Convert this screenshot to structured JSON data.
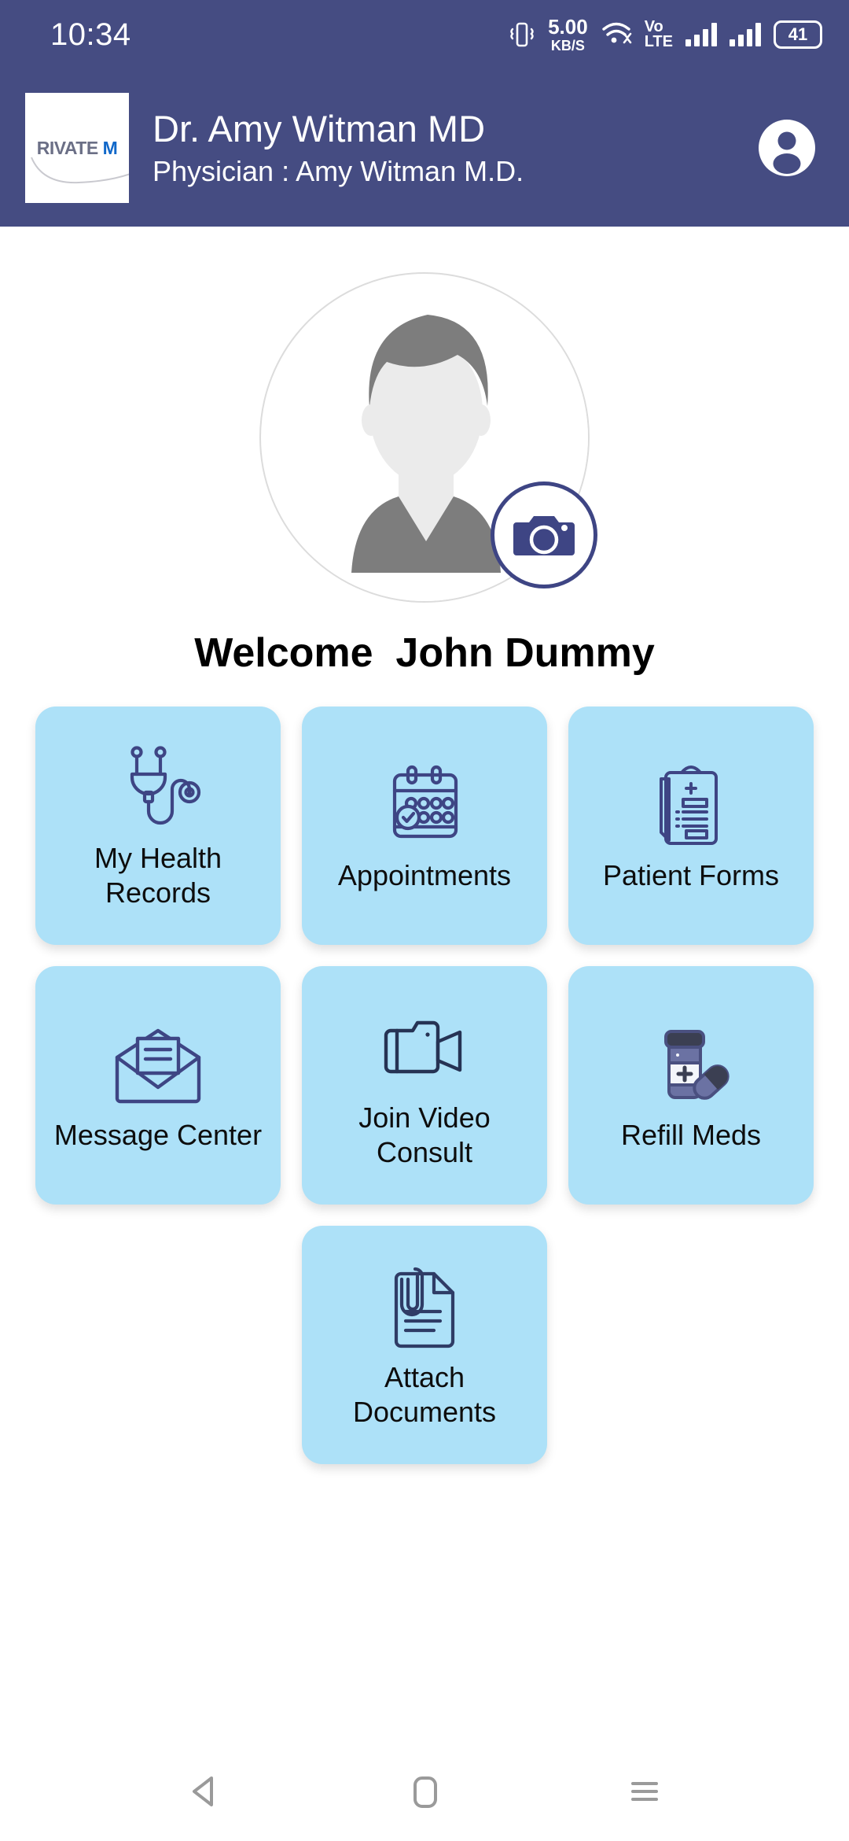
{
  "status_bar": {
    "time": "10:34",
    "vibrate_icon": "vibrate-icon",
    "network_speed_value": "5.00",
    "network_speed_unit": "KB/S",
    "wifi_icon": "wifi-icon",
    "volte_line1": "Vo",
    "volte_line2": "LTE",
    "signal_icon_1": "signal-bars-icon",
    "signal_icon_2": "signal-bars-icon",
    "battery_level": "41"
  },
  "header": {
    "logo_text_gray": "RIVATE ",
    "logo_text_blue": "M",
    "title": "Dr. Amy Witman MD",
    "subtitle": "Physician : Amy Witman M.D.",
    "account_icon": "account-circle-icon",
    "background_color": "#454C82"
  },
  "profile": {
    "avatar_icon": "user-avatar-placeholder",
    "camera_button_icon": "camera-icon",
    "welcome_text": "Welcome  John Dummy"
  },
  "menu": {
    "tile_color": "#ADE1F8",
    "icon_color": "#3E4584",
    "rows": [
      [
        {
          "label": "My Health\nRecords",
          "icon": "stethoscope-icon",
          "name": "my-health-records"
        },
        {
          "label": "Appointments",
          "icon": "calendar-check-icon",
          "name": "appointments"
        },
        {
          "label": "Patient Forms",
          "icon": "clipboard-medical-icon",
          "name": "patient-forms"
        }
      ],
      [
        {
          "label": "Message Center",
          "icon": "open-envelope-icon",
          "name": "message-center"
        },
        {
          "label": "Join Video\nConsult",
          "icon": "video-camera-icon",
          "name": "join-video-consult"
        },
        {
          "label": "Refill Meds",
          "icon": "pill-bottle-icon",
          "name": "refill-meds"
        }
      ],
      [
        {
          "label": "Attach\nDocuments",
          "icon": "document-paperclip-icon",
          "name": "attach-documents"
        }
      ]
    ]
  },
  "nav_bar": {
    "back_icon": "back-triangle-icon",
    "home_icon": "home-square-icon",
    "recents_icon": "recents-menu-icon"
  }
}
